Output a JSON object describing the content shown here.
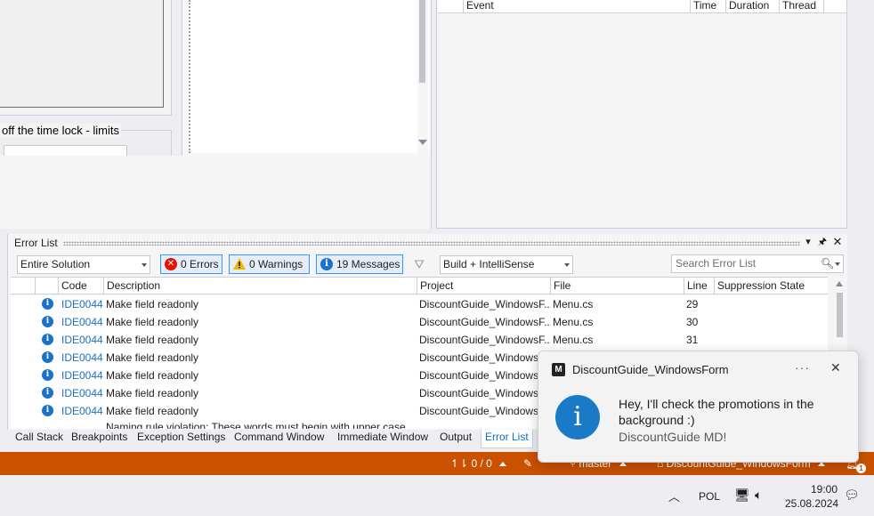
{
  "top_left": {
    "group_label": "off the time lock - limits"
  },
  "events_table": {
    "columns": [
      "Event",
      "Time",
      "Duration",
      "Thread"
    ]
  },
  "error_list": {
    "title": "Error List",
    "scope": "Entire Solution",
    "errors": "0 Errors",
    "warnings": "0 Warnings",
    "messages": "19 Messages",
    "build_filter": "Build + IntelliSense",
    "search_placeholder": "Search Error List",
    "columns": [
      "Code",
      "Description",
      "Project",
      "File",
      "Line",
      "Suppression State"
    ],
    "rows": [
      {
        "code": "IDE0044",
        "description": "Make field readonly",
        "project": "DiscountGuide_WindowsF...",
        "file": "Menu.cs",
        "line": "29"
      },
      {
        "code": "IDE0044",
        "description": "Make field readonly",
        "project": "DiscountGuide_WindowsF...",
        "file": "Menu.cs",
        "line": "30"
      },
      {
        "code": "IDE0044",
        "description": "Make field readonly",
        "project": "DiscountGuide_WindowsF...",
        "file": "Menu.cs",
        "line": "31"
      },
      {
        "code": "IDE0044",
        "description": "Make field readonly",
        "project": "DiscountGuide_WindowsF...",
        "file": "",
        "line": ""
      },
      {
        "code": "IDE0044",
        "description": "Make field readonly",
        "project": "DiscountGuide_Windows",
        "file": "",
        "line": ""
      },
      {
        "code": "IDE0044",
        "description": "Make field readonly",
        "project": "DiscountGuide_Windows",
        "file": "",
        "line": ""
      },
      {
        "code": "IDE0044",
        "description": "Make field readonly",
        "project": "DiscountGuide_Windows",
        "file": "",
        "line": ""
      }
    ],
    "partial_row": "Naming rule violation: These words must begin with upper case"
  },
  "bottom_tabs": [
    "Call Stack",
    "Breakpoints",
    "Exception Settings",
    "Command Window",
    "Immediate Window",
    "Output",
    "Error List"
  ],
  "status_bar": {
    "sync": "0 / 0",
    "branch": "master",
    "repo": "DiscountGuide_WindowsForm",
    "notification_count": "1"
  },
  "taskbar": {
    "language": "POL",
    "time": "19:00",
    "date": "25.08.2024"
  },
  "toast": {
    "app_name": "DiscountGuide_WindowsForm",
    "message": "Hey, I'll check the promotions in the background :)",
    "attribution": "DiscountGuide MD!"
  },
  "colors": {
    "status_bar": "#ca5100",
    "link": "#1a6fc2",
    "info": "#1b7ac7"
  }
}
